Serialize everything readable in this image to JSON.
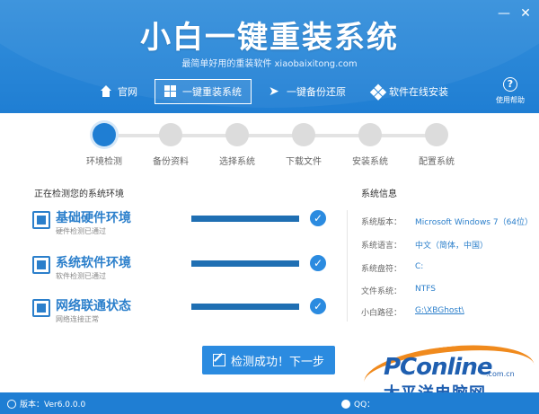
{
  "header": {
    "title": "小白一键重装系统",
    "subtitle": "最简单好用的重装软件 xiaobaixitong.com",
    "window_min": "—",
    "window_close": "✕",
    "nav": [
      {
        "label": "官网",
        "icon": "home-icon"
      },
      {
        "label": "一键重装系统",
        "icon": "windows-icon",
        "active": true
      },
      {
        "label": "一键备份还原",
        "icon": "bird-icon"
      },
      {
        "label": "软件在线安装",
        "icon": "grid-icon"
      }
    ],
    "help_label": "使用帮助",
    "help_symbol": "?"
  },
  "stepper": {
    "steps": [
      {
        "label": "环境检测",
        "active": true
      },
      {
        "label": "备份资料",
        "active": false
      },
      {
        "label": "选择系统",
        "active": false
      },
      {
        "label": "下载文件",
        "active": false
      },
      {
        "label": "安装系统",
        "active": false
      },
      {
        "label": "配置系统",
        "active": false
      }
    ]
  },
  "checks": {
    "title": "正在检测您的系统环境",
    "items": [
      {
        "name": "基础硬件环境",
        "status": "硬件检测已通过",
        "progress": 1.0,
        "icon": "hardware-icon",
        "ok": "✓"
      },
      {
        "name": "系统软件环境",
        "status": "软件检测已通过",
        "progress": 1.0,
        "icon": "software-icon",
        "ok": "✓"
      },
      {
        "name": "网络联通状态",
        "status": "网络连接正常",
        "progress": 1.0,
        "icon": "network-icon",
        "ok": "✓"
      }
    ]
  },
  "system_info": {
    "title": "系统信息",
    "rows": [
      {
        "key": "系统版本：",
        "value": "Microsoft Windows 7（64位）"
      },
      {
        "key": "系统语言：",
        "value": "中文（简体，中国）"
      },
      {
        "key": "系统盘符：",
        "value": "C:"
      },
      {
        "key": "文件系统：",
        "value": "NTFS"
      },
      {
        "key": "小白路径：",
        "value": "G:\\XBGhost\\"
      }
    ]
  },
  "next_button": "检测成功！下一步",
  "footer": {
    "version": "版本：Ver6.0.0.0",
    "right": "QQ："
  },
  "watermark": {
    "brand": "PConline",
    "domain": ".com.cn",
    "cn": "太平洋电脑网"
  },
  "colors": {
    "primary": "#1f7ed3",
    "accent": "#2b8be0",
    "watermark_orange": "#f08a1d"
  }
}
